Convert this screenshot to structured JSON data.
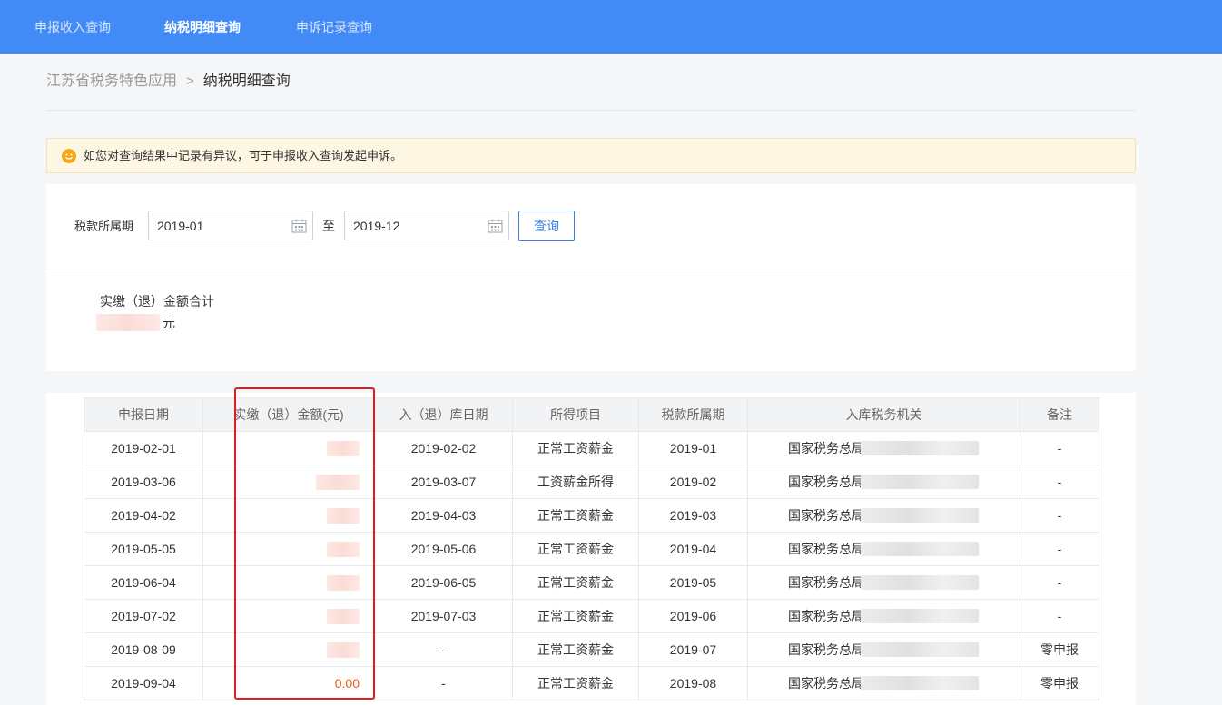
{
  "nav": {
    "tabs": [
      {
        "label": "申报收入查询",
        "active": false
      },
      {
        "label": "纳税明细查询",
        "active": true
      },
      {
        "label": "申诉记录查询",
        "active": false
      }
    ]
  },
  "breadcrumb": {
    "root": "江苏省税务特色应用",
    "separator": ">",
    "current": "纳税明细查询"
  },
  "notice": {
    "text": "如您对查询结果中记录有异议，可于申报收入查询发起申诉。",
    "icon": "smile-icon"
  },
  "filter": {
    "label": "税款所属期",
    "start": "2019-01",
    "to_label": "至",
    "end": "2019-12",
    "button": "查询"
  },
  "summary": {
    "label": "实缴（退）金额合计",
    "unit": "元"
  },
  "table": {
    "headers": [
      "申报日期",
      "实缴（退）金额(元)",
      "入（退）库日期",
      "所得项目",
      "税款所属期",
      "入库税务机关",
      "备注"
    ],
    "rows": [
      {
        "date": "2019-02-01",
        "amount": "",
        "store_date": "2019-02-02",
        "item": "正常工资薪金",
        "period": "2019-01",
        "org": "国家税务总局",
        "note": "-"
      },
      {
        "date": "2019-03-06",
        "amount": "",
        "store_date": "2019-03-07",
        "item": "工资薪金所得",
        "period": "2019-02",
        "org": "国家税务总局",
        "note": "-"
      },
      {
        "date": "2019-04-02",
        "amount": "",
        "store_date": "2019-04-03",
        "item": "正常工资薪金",
        "period": "2019-03",
        "org": "国家税务总局",
        "note": "-"
      },
      {
        "date": "2019-05-05",
        "amount": "",
        "store_date": "2019-05-06",
        "item": "正常工资薪金",
        "period": "2019-04",
        "org": "国家税务总局",
        "note": "-"
      },
      {
        "date": "2019-06-04",
        "amount": "",
        "store_date": "2019-06-05",
        "item": "正常工资薪金",
        "period": "2019-05",
        "org": "国家税务总局",
        "note": "-"
      },
      {
        "date": "2019-07-02",
        "amount": "",
        "store_date": "2019-07-03",
        "item": "正常工资薪金",
        "period": "2019-06",
        "org": "国家税务总局",
        "note": "-"
      },
      {
        "date": "2019-08-09",
        "amount": "",
        "store_date": "-",
        "item": "正常工资薪金",
        "period": "2019-07",
        "org": "国家税务总局",
        "note": "零申报"
      },
      {
        "date": "2019-09-04",
        "amount": "0.00",
        "store_date": "-",
        "item": "正常工资薪金",
        "period": "2019-08",
        "org": "国家税务总局",
        "note": "零申报"
      }
    ]
  },
  "colors": {
    "nav_bg": "#428bf6",
    "highlight_border": "#e21c1c",
    "zero_amount": "#ee5a1e",
    "notice_bg": "#fdf6e3"
  }
}
